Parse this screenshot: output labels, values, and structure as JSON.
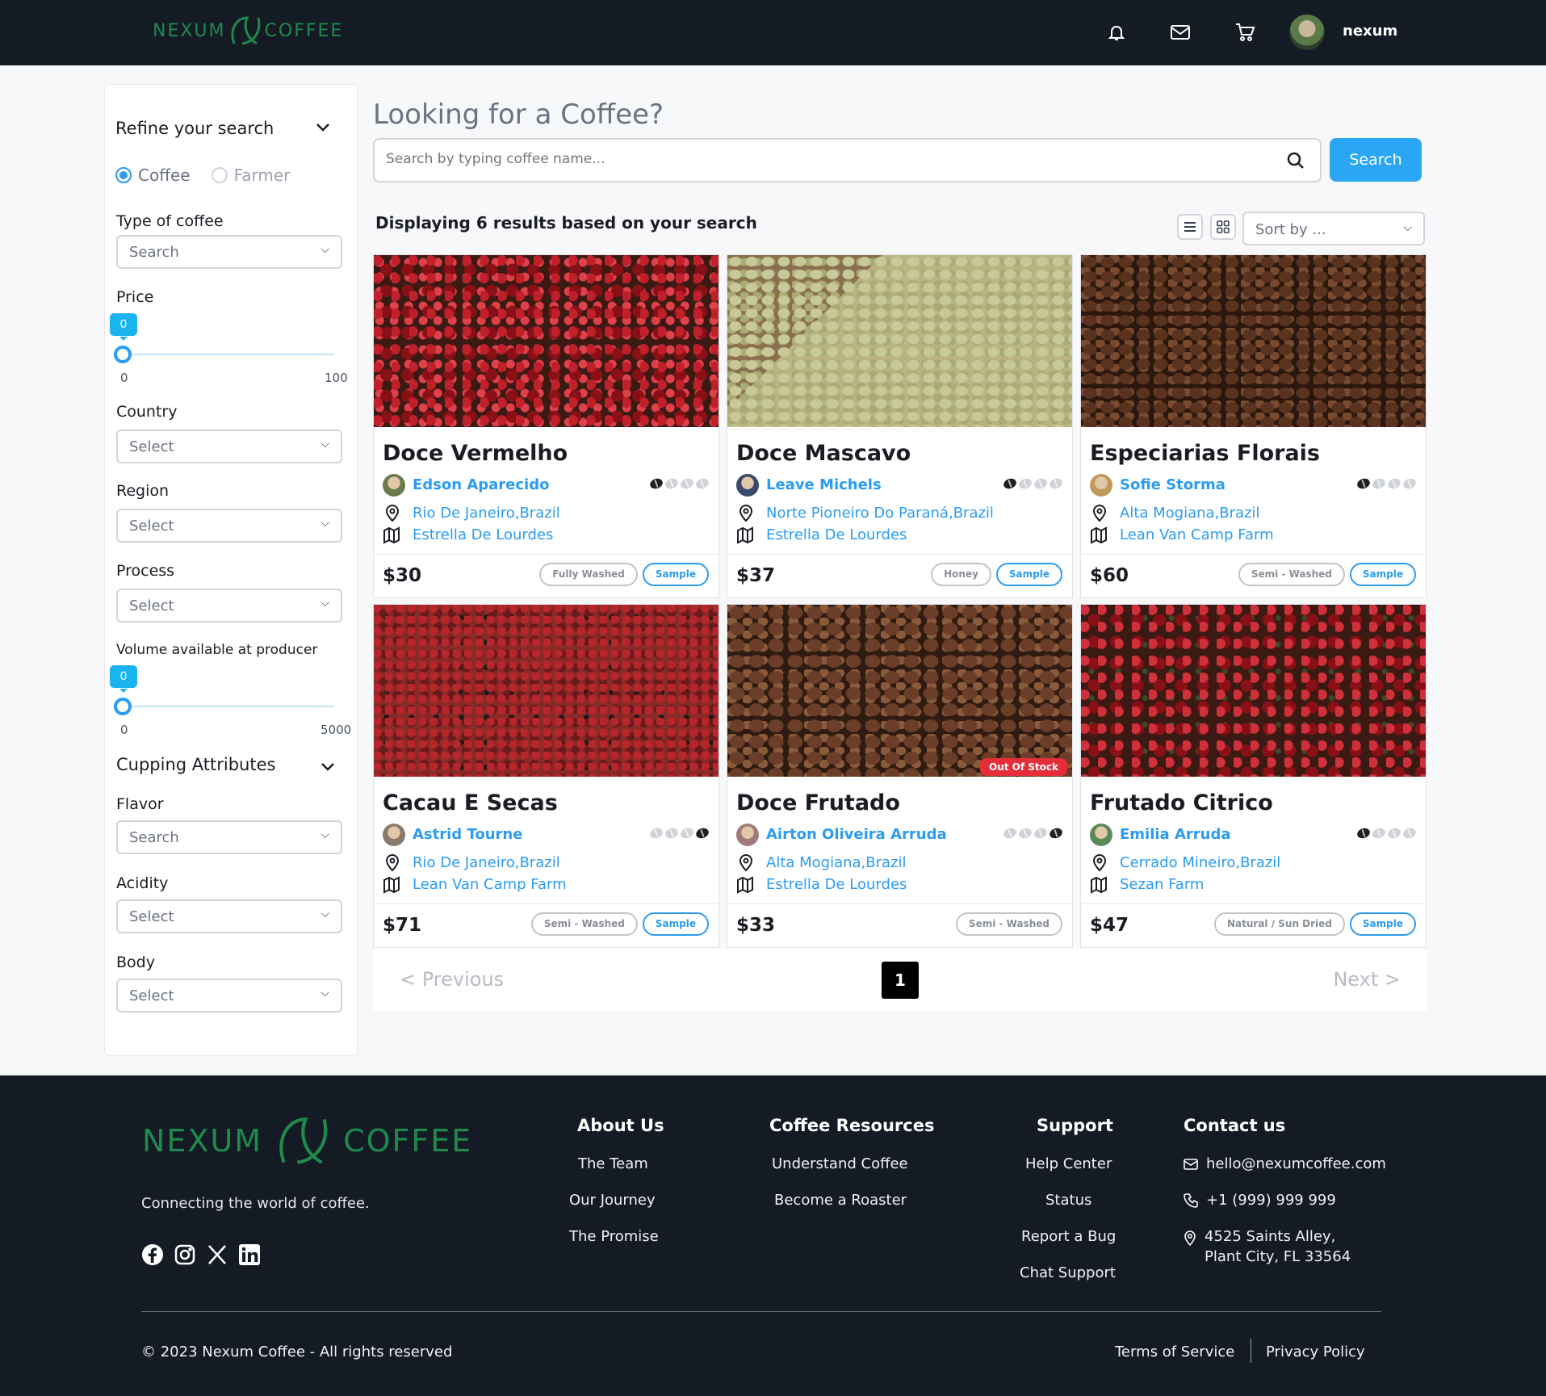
{
  "header": {
    "brand_left": "NEXUM",
    "brand_right": "COFFEE",
    "username": "nexum",
    "icons": [
      "bell-icon",
      "mail-icon",
      "cart-icon"
    ]
  },
  "sidebar": {
    "title": "Refine your search",
    "mode_options": [
      "Coffee",
      "Farmer"
    ],
    "mode_selected": "Coffee",
    "type_label": "Type of coffee",
    "type_value": "Search",
    "price_label": "Price",
    "price_value": "0",
    "price_min": "0",
    "price_max": "100",
    "country_label": "Country",
    "country_value": "Select",
    "region_label": "Region",
    "region_value": "Select",
    "process_label": "Process",
    "process_value": "Select",
    "volume_label": "Volume available at producer",
    "volume_value": "0",
    "volume_min": "0",
    "volume_max": "5000",
    "cupping_title": "Cupping Attributes",
    "flavor_label": "Flavor",
    "flavor_value": "Search",
    "acidity_label": "Acidity",
    "acidity_value": "Select",
    "body_label": "Body",
    "body_value": "Select"
  },
  "main": {
    "title": "Looking for a Coffee?",
    "search_placeholder": "Search by typing coffee name...",
    "search_button": "Search",
    "results_text": "Displaying 6 results based on your search",
    "sort_value": "Sort by ..."
  },
  "cards": [
    {
      "name": "Doce Vermelho",
      "farmer": "Edson Aparecido",
      "location": "Rio De Janeiro,Brazil",
      "farm": "Estrella De Lourdes",
      "price": "$30",
      "tags": [
        "Fully Washed",
        "Sample"
      ],
      "roast_level": 1,
      "image": "red-cherries",
      "out_of_stock": ""
    },
    {
      "name": "Doce Mascavo",
      "farmer": "Leave Michels",
      "location": "Norte Pioneiro Do Paraná,Brazil",
      "farm": "Estrella De Lourdes",
      "price": "$37",
      "tags": [
        "Honey",
        "Sample"
      ],
      "roast_level": 1,
      "image": "green-beans",
      "out_of_stock": ""
    },
    {
      "name": "Especiarias Florais",
      "farmer": "Sofie Storma",
      "location": "Alta Mogiana,Brazil",
      "farm": "Lean Van Camp Farm",
      "price": "$60",
      "tags": [
        "Semi - Washed",
        "Sample"
      ],
      "roast_level": 1,
      "image": "roasted-beans",
      "out_of_stock": ""
    },
    {
      "name": "Cacau E Secas",
      "farmer": "Astrid Tourne",
      "location": "Rio De Janeiro,Brazil",
      "farm": "Lean Van Camp Farm",
      "price": "$71",
      "tags": [
        "Semi - Washed",
        "Sample"
      ],
      "roast_level": 4,
      "image": "drying-cherries",
      "out_of_stock": ""
    },
    {
      "name": "Doce Frutado",
      "farmer": "Airton Oliveira Arruda",
      "location": "Alta Mogiana,Brazil",
      "farm": "Estrella De Lourdes",
      "price": "$33",
      "tags": [
        "Semi - Washed"
      ],
      "roast_level": 4,
      "image": "roasted-beans-2",
      "out_of_stock": "Out Of Stock"
    },
    {
      "name": "Frutado Citrico",
      "farmer": "Emilia Arruda",
      "location": "Cerrado Mineiro,Brazil",
      "farm": "Sezan Farm",
      "price": "$47",
      "tags": [
        "Natural / Sun Dried",
        "Sample"
      ],
      "roast_level": 1,
      "image": "red-cherries-2",
      "out_of_stock": ""
    }
  ],
  "pagination": {
    "prev": "< Previous",
    "next": "Next >",
    "current": "1"
  },
  "footer": {
    "brand_left": "NEXUM",
    "brand_right": "COFFEE",
    "tagline": "Connecting the world of coffee.",
    "socials": [
      "facebook-icon",
      "instagram-icon",
      "x-icon",
      "linkedin-icon"
    ],
    "about": {
      "title": "About Us",
      "links": [
        "The Team",
        "Our Journey",
        "The Promise"
      ]
    },
    "resources": {
      "title": "Coffee Resources",
      "links": [
        "Understand Coffee",
        "Become a Roaster"
      ]
    },
    "support": {
      "title": "Support",
      "links": [
        "Help Center",
        "Status",
        "Report a Bug",
        "Chat Support"
      ]
    },
    "contact": {
      "title": "Contact us",
      "email": "hello@nexumcoffee.com",
      "phone": "+1 (999) 999 999",
      "address_1": "4525 Saints Alley,",
      "address_2": "Plant City, FL 33564"
    },
    "copyright": "© 2023 Nexum Coffee - All rights reserved",
    "terms": "Terms of Service",
    "privacy": "Privacy Policy"
  },
  "colors": {
    "accent": "#2ba5f5",
    "brand_green": "#1f8a4c",
    "dark": "#141b25",
    "danger": "#e52e3a"
  }
}
